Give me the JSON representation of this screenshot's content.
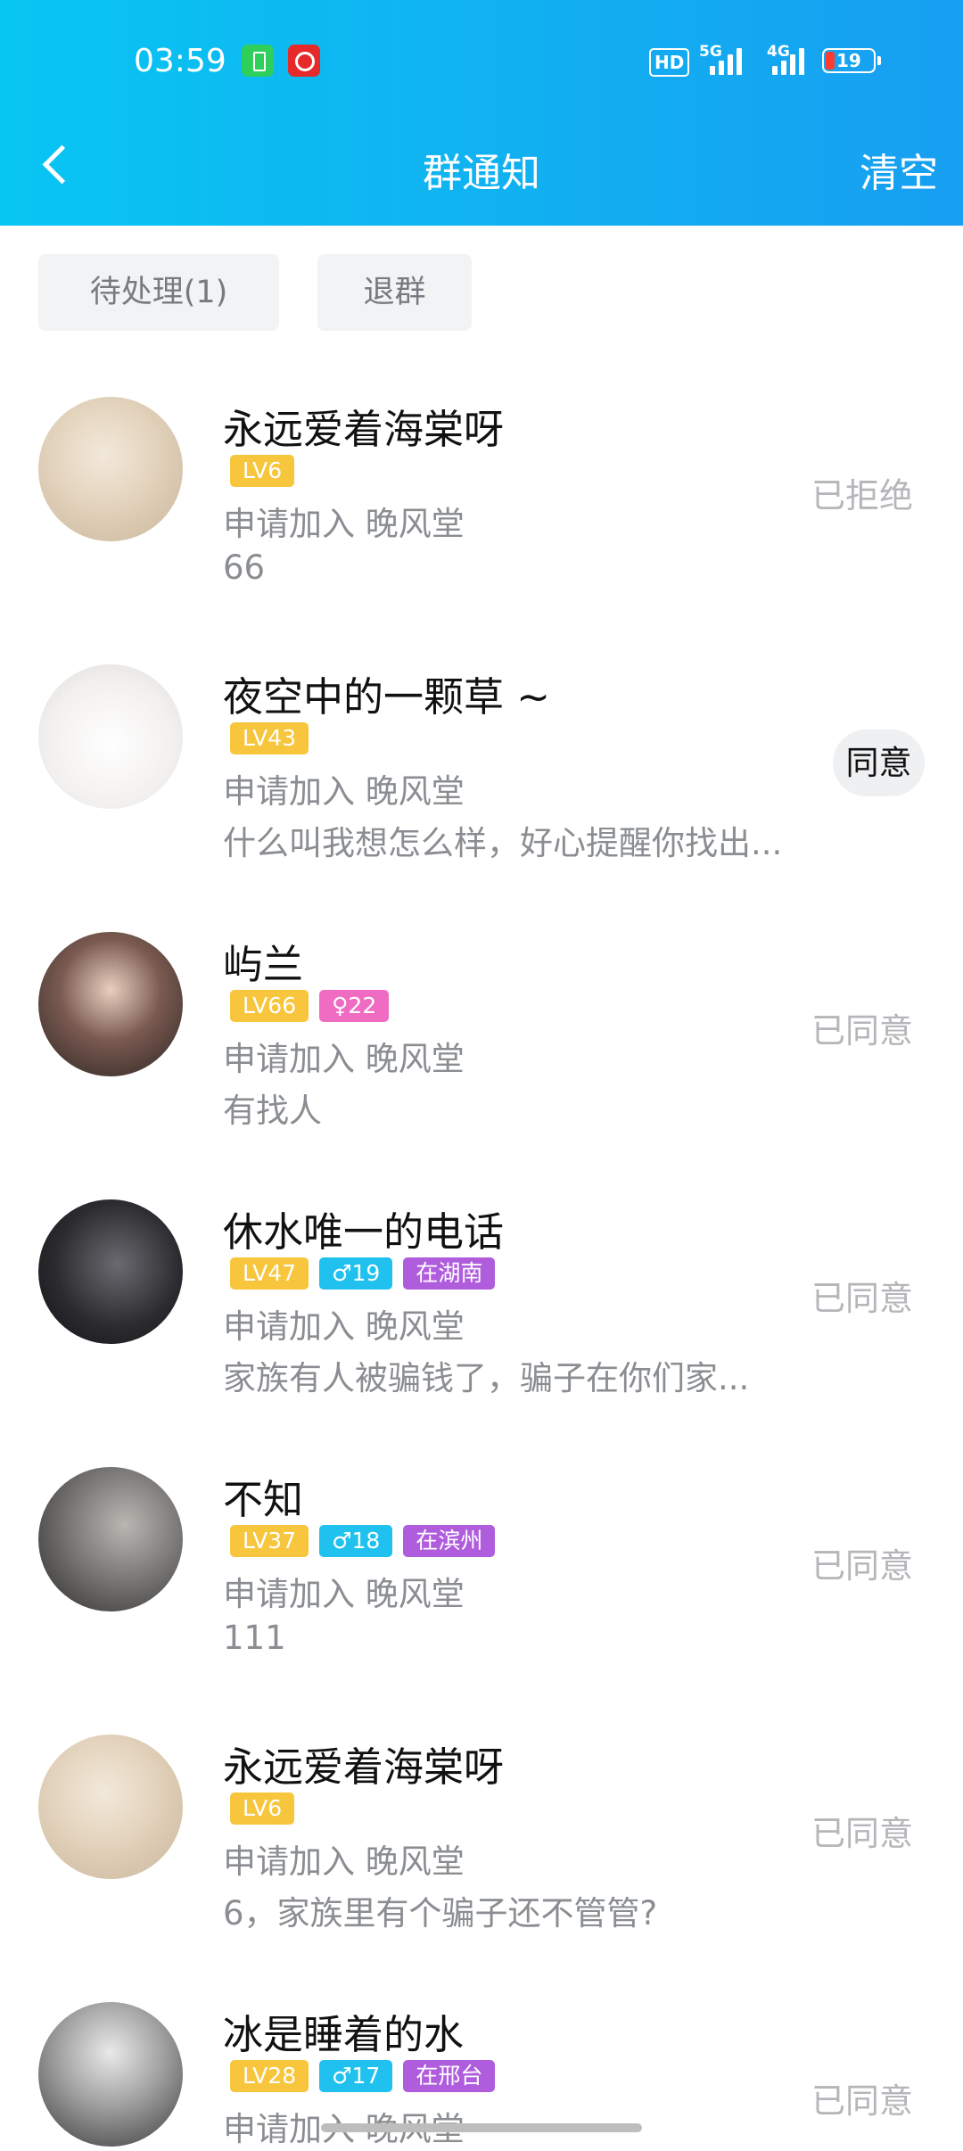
{
  "status_bar": {
    "time": "03:59",
    "hd": "HD",
    "net1": "5G",
    "net2": "4G",
    "battery": "19"
  },
  "header": {
    "title": "群通知",
    "right_action": "清空"
  },
  "tabs": [
    {
      "label": "待处理(1)"
    },
    {
      "label": "退群"
    }
  ],
  "requests": [
    {
      "name": "永远爱着海棠呀",
      "tags": [
        {
          "text": "LV6",
          "kind": "lv"
        }
      ],
      "request": "申请加入 晚风堂",
      "message": "66",
      "status": "已拒绝",
      "avatar": "avatar-anime-girl"
    },
    {
      "name": "夜空中的一颗草 ~",
      "tags": [
        {
          "text": "LV43",
          "kind": "lv"
        }
      ],
      "request": "申请加入 晚风堂",
      "message": "什么叫我想怎么样，好心提醒你找出...",
      "status": "同意",
      "avatar": "avatar-hamster"
    },
    {
      "name": "屿兰",
      "tags": [
        {
          "text": "LV66",
          "kind": "lv"
        },
        {
          "text": "♀22",
          "kind": "f"
        }
      ],
      "request": "申请加入 晚风堂",
      "message": "有找人",
      "status": "已同意",
      "avatar": "avatar-photo"
    },
    {
      "name": "休水唯一的电话",
      "tags": [
        {
          "text": "LV47",
          "kind": "lv"
        },
        {
          "text": "♂19",
          "kind": "m"
        },
        {
          "text": "在湖南",
          "kind": "loc"
        }
      ],
      "request": "申请加入 晚风堂",
      "message": "家族有人被骗钱了，骗子在你们家...",
      "status": "已同意",
      "avatar": "avatar-dark"
    },
    {
      "name": "不知",
      "tags": [
        {
          "text": "LV37",
          "kind": "lv"
        },
        {
          "text": "♂18",
          "kind": "m"
        },
        {
          "text": "在滨州",
          "kind": "loc"
        }
      ],
      "request": "申请加入 晚风堂",
      "message": "111",
      "status": "已同意",
      "avatar": "avatar-silhouette"
    },
    {
      "name": "永远爱着海棠呀",
      "tags": [
        {
          "text": "LV6",
          "kind": "lv"
        }
      ],
      "request": "申请加入 晚风堂",
      "message": "6，家族里有个骗子还不管管?",
      "status": "已同意",
      "avatar": "avatar-anime-girl"
    },
    {
      "name": "冰是睡着的水",
      "tags": [
        {
          "text": "LV28",
          "kind": "lv"
        },
        {
          "text": "♂17",
          "kind": "m"
        },
        {
          "text": "在邢台",
          "kind": "loc"
        }
      ],
      "request": "申请加入 晚风堂",
      "message": "",
      "status": "已同意",
      "avatar": "avatar-ink"
    }
  ]
}
